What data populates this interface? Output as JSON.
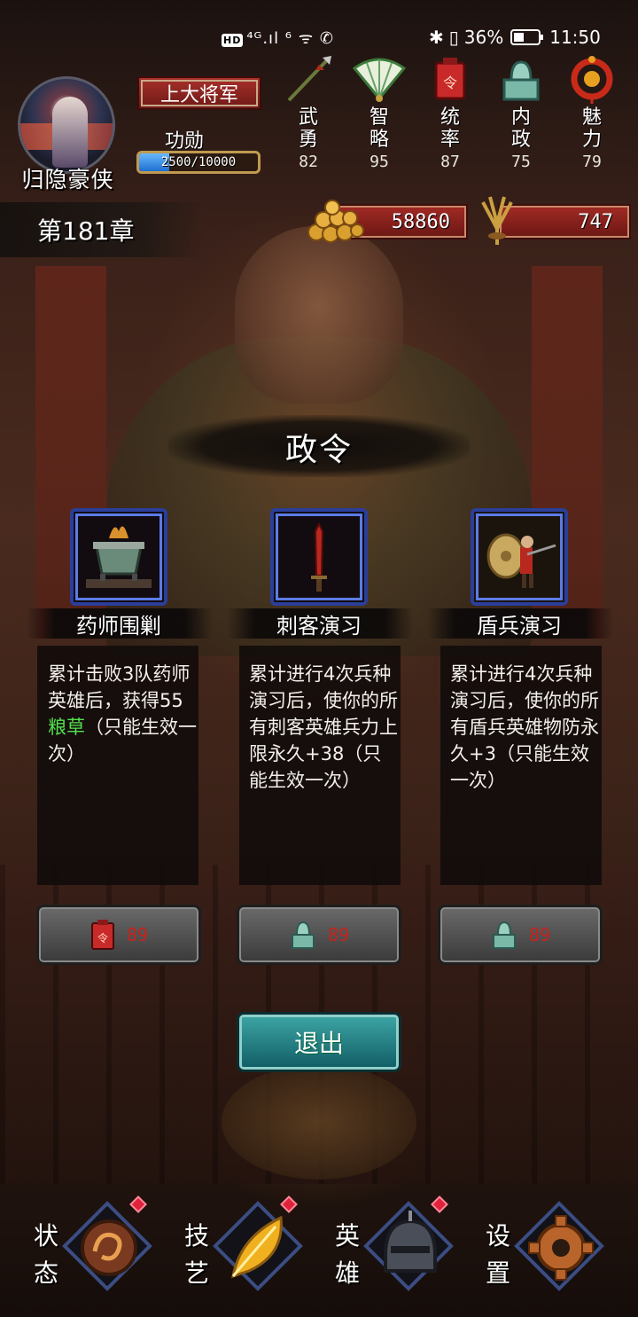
{
  "status_bar": {
    "left_text": "⁴ᴳ.ıl ⁶ ᯤ ✆",
    "battery_percent": "36%",
    "time": "11:50"
  },
  "player": {
    "name": "归隐豪侠",
    "rank": "上大将军",
    "merit_label": "功勋",
    "merit_text": "2500/10000",
    "merit_fraction": 0.25
  },
  "attributes": [
    {
      "name": "武勇",
      "value": "82",
      "icon": "spear-icon"
    },
    {
      "name": "智略",
      "value": "95",
      "icon": "fan-icon"
    },
    {
      "name": "统率",
      "value": "87",
      "icon": "command-token-icon"
    },
    {
      "name": "内政",
      "value": "75",
      "icon": "jade-seal-icon"
    },
    {
      "name": "魅力",
      "value": "79",
      "icon": "red-charm-icon"
    }
  ],
  "chapter": "第181章",
  "resources": {
    "coins": "58860",
    "grain": "747"
  },
  "decree_title": "政令",
  "cards": [
    {
      "name": "药师围剿",
      "desc_before": "累计击败3队药师英雄后，获得55",
      "desc_highlight": "粮草",
      "desc_after": "（只能生效一次）",
      "icon": "cauldron-icon",
      "cost": "89",
      "cost_icon": "command-token-icon"
    },
    {
      "name": "刺客演习",
      "desc_before": "累计进行4次兵种演习后，使你的所有刺客英雄兵力上限永久+38（只能生效一次）",
      "desc_highlight": "",
      "desc_after": "",
      "icon": "dagger-icon",
      "cost": "89",
      "cost_icon": "jade-seal-icon"
    },
    {
      "name": "盾兵演习",
      "desc_before": "累计进行4次兵种演习后，使你的所有盾兵英雄物防永久+3（只能生效一次）",
      "desc_highlight": "",
      "desc_after": "",
      "icon": "shield-soldier-icon",
      "cost": "89",
      "cost_icon": "jade-seal-icon"
    }
  ],
  "exit_label": "退出",
  "nav": [
    {
      "label": "状态",
      "icon": "dragon-medallion-icon",
      "badge": true
    },
    {
      "label": "技艺",
      "icon": "golden-leaf-icon",
      "badge": true
    },
    {
      "label": "英雄",
      "icon": "helmet-icon",
      "badge": true
    },
    {
      "label": "设置",
      "icon": "gear-icon",
      "badge": false
    }
  ],
  "colors": {
    "highlight_green": "#52e34e",
    "cost_red": "#c8221c",
    "card_border_blue": "#2a3e9a",
    "exit_teal": "#2a8a8e"
  }
}
